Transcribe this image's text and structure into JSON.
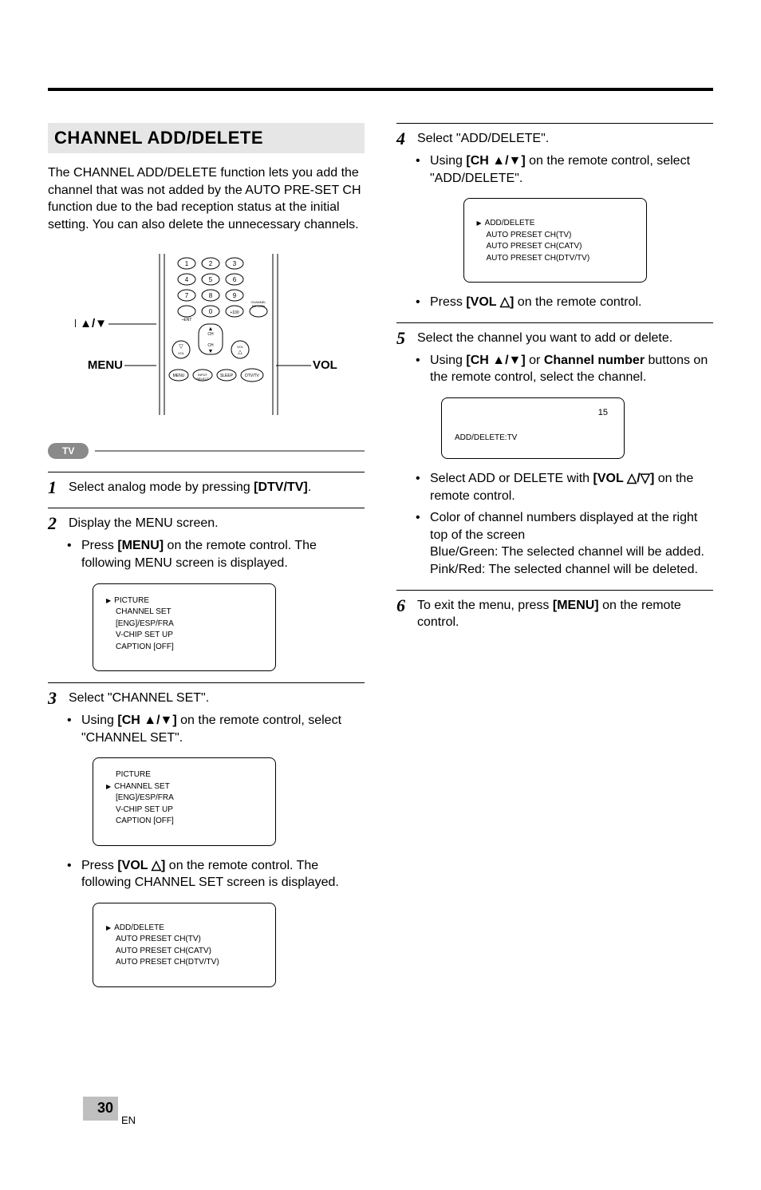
{
  "page": {
    "number": "30",
    "lang": "EN"
  },
  "left": {
    "title": "CHANNEL ADD/DELETE",
    "intro": "The CHANNEL ADD/DELETE function lets you add the channel that was not added by the AUTO PRE-SET CH function due to the bad reception status at the initial setting. You can also delete the unnecessary channels.",
    "labels": {
      "ch": "CH ▲/▼",
      "menu": "MENU",
      "vol": "VOL △/▽",
      "tv": "TV",
      "remote_btns": {
        "ent": "–ENT",
        "plus100": "+100",
        "chret": "CHANNEL RETURN",
        "menu": "MENU",
        "input": "INPUT SELECT",
        "sleep": "SLEEP",
        "dtvtv": "DTV/TV",
        "ch_up": "CH",
        "ch_dn": "CH",
        "vol_dn": "VOL",
        "vol_up": "VOL"
      }
    },
    "step1": {
      "pre": "Select analog mode by pressing ",
      "bold": "[DTV/TV]",
      "post": "."
    },
    "step2": {
      "head": "Display the MENU screen.",
      "bullet_pre": "Press ",
      "bullet_bold": "[MENU]",
      "bullet_post": " on the remote control. The following MENU screen is displayed."
    },
    "osd_menu1": {
      "l1": "PICTURE",
      "l2": "CHANNEL SET",
      "l3": "[ENG]/ESP/FRA",
      "l4": "V-CHIP SET UP",
      "l5": "CAPTION [OFF]"
    },
    "step3": {
      "head": "Select \"CHANNEL SET\".",
      "bullet_pre": "Using ",
      "bullet_bold": "[CH ▲/▼]",
      "bullet_post": " on the remote control, select \"CHANNEL SET\"."
    },
    "osd_menu2": {
      "l1": "PICTURE",
      "l2": "CHANNEL SET",
      "l3": "[ENG]/ESP/FRA",
      "l4": "V-CHIP SET UP",
      "l5": "CAPTION [OFF]"
    },
    "step3b": {
      "pre": "Press ",
      "bold": "[VOL △]",
      "post": " on the remote control. The following CHANNEL SET screen is displayed."
    },
    "osd_chset": {
      "l1": "ADD/DELETE",
      "l2": "AUTO PRESET CH(TV)",
      "l3": "AUTO PRESET CH(CATV)",
      "l4": "AUTO PRESET CH(DTV/TV)"
    }
  },
  "right": {
    "step4": {
      "head": "Select \"ADD/DELETE\".",
      "bullet_pre": "Using ",
      "bullet_bold": "[CH ▲/▼]",
      "bullet_post": " on the remote control, select \"ADD/DELETE\"."
    },
    "osd_add": {
      "l1": "ADD/DELETE",
      "l2": "AUTO PRESET CH(TV)",
      "l3": "AUTO PRESET CH(CATV)",
      "l4": "AUTO PRESET CH(DTV/TV)"
    },
    "step4b": {
      "pre": "Press ",
      "bold": "[VOL △]",
      "post": " on the remote control."
    },
    "step5": {
      "head": "Select the channel you want to add or delete.",
      "bullet_pre": "Using ",
      "bullet_bold1": "[CH ▲/▼]",
      "bullet_mid": " or ",
      "bullet_bold2": "Channel number",
      "bullet_post": " buttons on the remote control, select the channel."
    },
    "osd_ch": {
      "num": "15",
      "label": "ADD/DELETE:TV"
    },
    "step5b": {
      "pre": "Select ADD or DELETE with ",
      "bold": "[VOL △/▽]",
      "post": " on the remote control."
    },
    "step5c": {
      "l1": "Color of channel numbers displayed at the right top of the screen",
      "l2": "Blue/Green: The selected channel will be added.",
      "l3": "Pink/Red: The selected channel will be deleted."
    },
    "step6": {
      "pre": "To exit the menu, press ",
      "bold": "[MENU]",
      "post": " on the remote control."
    }
  }
}
